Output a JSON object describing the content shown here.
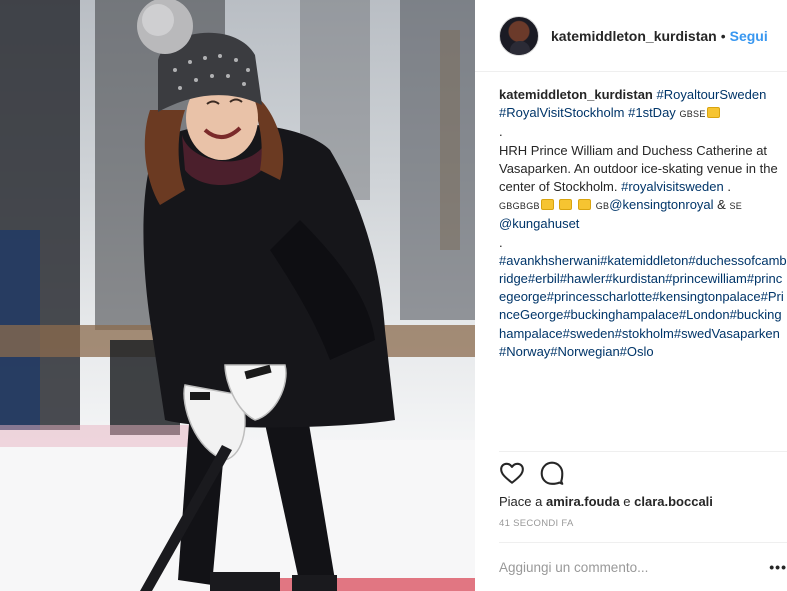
{
  "post": {
    "username": "katemiddleton_kurdistan",
    "separator": "•",
    "follow_label": "Segui"
  },
  "caption": {
    "username": "katemiddleton_kurdistan",
    "tag_royaltour": "#RoyaltourSweden",
    "tag_royalvisit": "#RoyalVisitStockholm",
    "tag_firstday": "#1stDay",
    "flag_gbse": "GBSE",
    "dot1": ".",
    "body_text": "HRH Prince William and Duchess Catherine at Vasaparken. An outdoor ice-skating venue in the center of Stockholm.",
    "tag_royalvisitsweden": "#royalvisitsweden",
    "after_tag": " .",
    "flag_gbgbgb": "GBGBGB",
    "flag_gb": "GB",
    "mention_kensington": "@kensingtonroyal",
    "amp": " & ",
    "flag_se": "SE",
    "mention_kungahuset": "@kungahuset",
    "dot2": ".",
    "hashtags": "#avankhsherwani#katemiddleton#duchessofcambridge#erbil#hawler#kurdistan#princewilliam#princegeorge#princesscharlotte#kensingtonpalace#PrinceGeorge#buckinghampalace#London#buckinghampalace#sweden#stokholm#swedVasaparken#Norway#Norwegian#Oslo"
  },
  "actions": {
    "like_icon": "heart-outline-icon",
    "comment_icon": "speech-bubble-icon"
  },
  "likes": {
    "prefix": "Piace a ",
    "user1": "amira.fouda",
    "conjunction": " e ",
    "user2": "clara.boccali"
  },
  "timestamp": "41 secondi fa",
  "comment": {
    "placeholder": "Aggiungi un commento...",
    "more_label": "•••"
  },
  "colors": {
    "link": "#003569",
    "follow": "#3897f0",
    "muted": "#999999",
    "text": "#262626",
    "border": "#efefef"
  }
}
